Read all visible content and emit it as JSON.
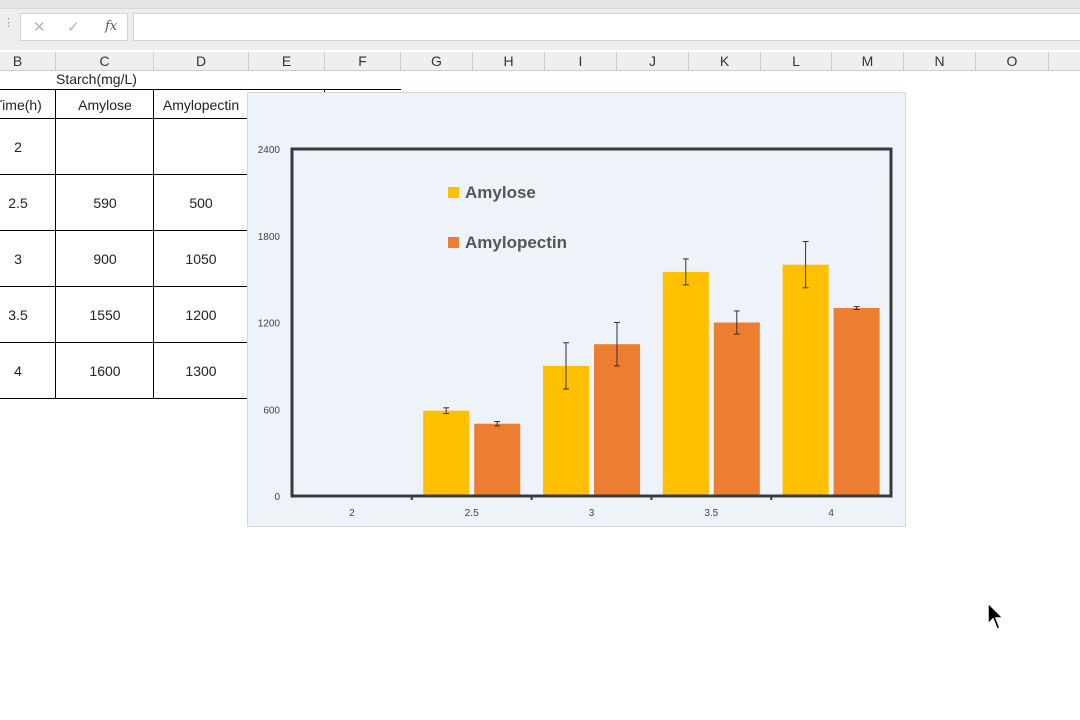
{
  "formula_bar": {
    "cancel_icon": "✕",
    "enter_icon": "✓",
    "fx_icon": "fx",
    "value": ""
  },
  "columns": [
    "B",
    "C",
    "D",
    "E",
    "F",
    "G",
    "H",
    "I",
    "J",
    "K",
    "L",
    "M",
    "N",
    "O"
  ],
  "sheet": {
    "group_header": "Starch(mg/L)",
    "headers": [
      "Time(h)",
      "Amylose",
      "Amylopectin"
    ],
    "rows": [
      [
        "2",
        "",
        ""
      ],
      [
        "2.5",
        "590",
        "500"
      ],
      [
        "3",
        "900",
        "1050"
      ],
      [
        "3.5",
        "1550",
        "1200"
      ],
      [
        "4",
        "1600",
        "1300"
      ]
    ]
  },
  "chart_data": {
    "type": "bar",
    "categories": [
      "2",
      "2.5",
      "3",
      "3.5",
      "4"
    ],
    "series": [
      {
        "name": "Amylose",
        "color": "#ffc000",
        "values": [
          0,
          590,
          900,
          1550,
          1600
        ],
        "errors": [
          0,
          20,
          160,
          90,
          160
        ]
      },
      {
        "name": "Amylopectin",
        "color": "#ed7d31",
        "values": [
          0,
          500,
          1050,
          1200,
          1300
        ],
        "errors": [
          0,
          15,
          150,
          80,
          10
        ]
      }
    ],
    "yticks": [
      "2400",
      "1800",
      "1200",
      "600",
      "0"
    ],
    "ylim": [
      0,
      2400
    ],
    "title": "",
    "xlabel": "",
    "ylabel": "",
    "legend_position": "top-left inside"
  }
}
